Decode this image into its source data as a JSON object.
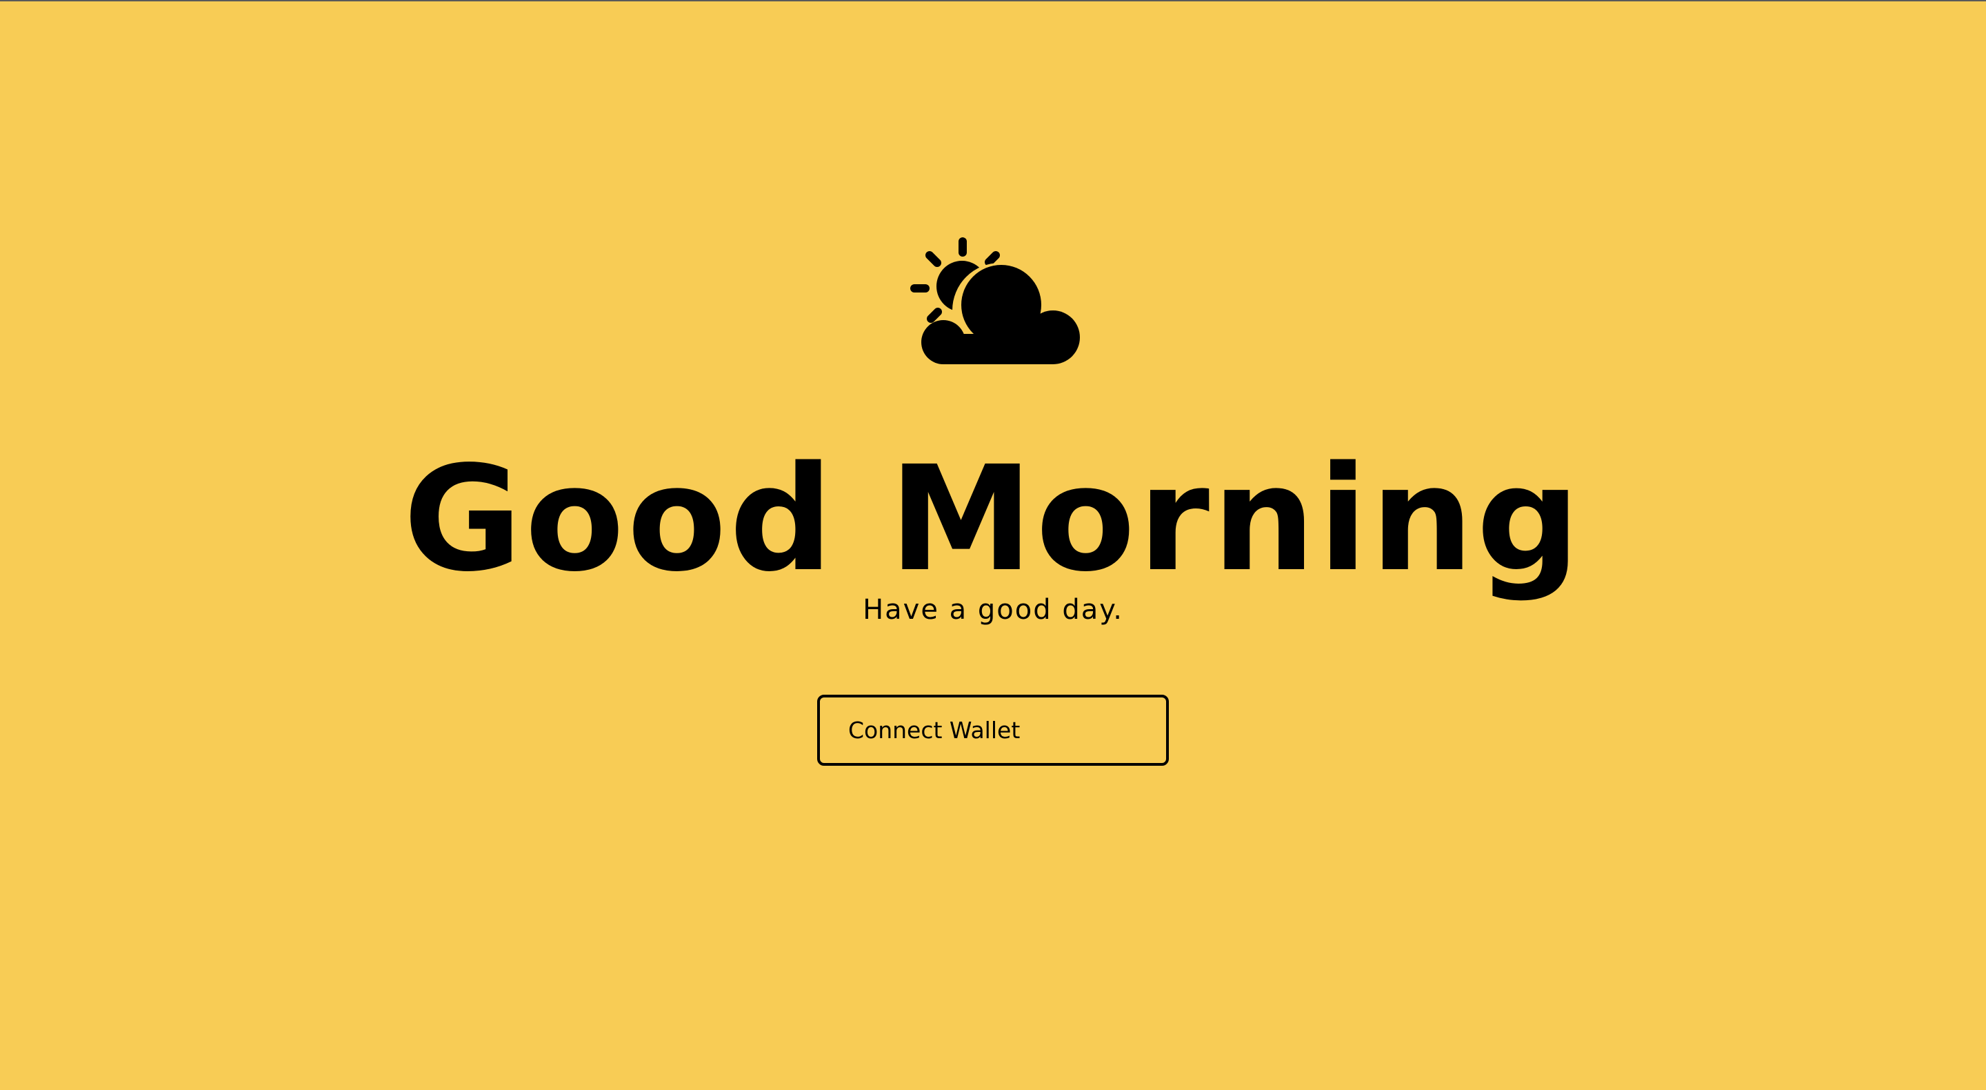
{
  "page": {
    "background_color": "#f8cc55",
    "text_color": "#000000"
  },
  "hero": {
    "icon": "partly-cloudy-icon",
    "greeting": "Good Morning",
    "subtitle": "Have a good day."
  },
  "actions": {
    "connect_wallet_label": "Connect Wallet"
  }
}
